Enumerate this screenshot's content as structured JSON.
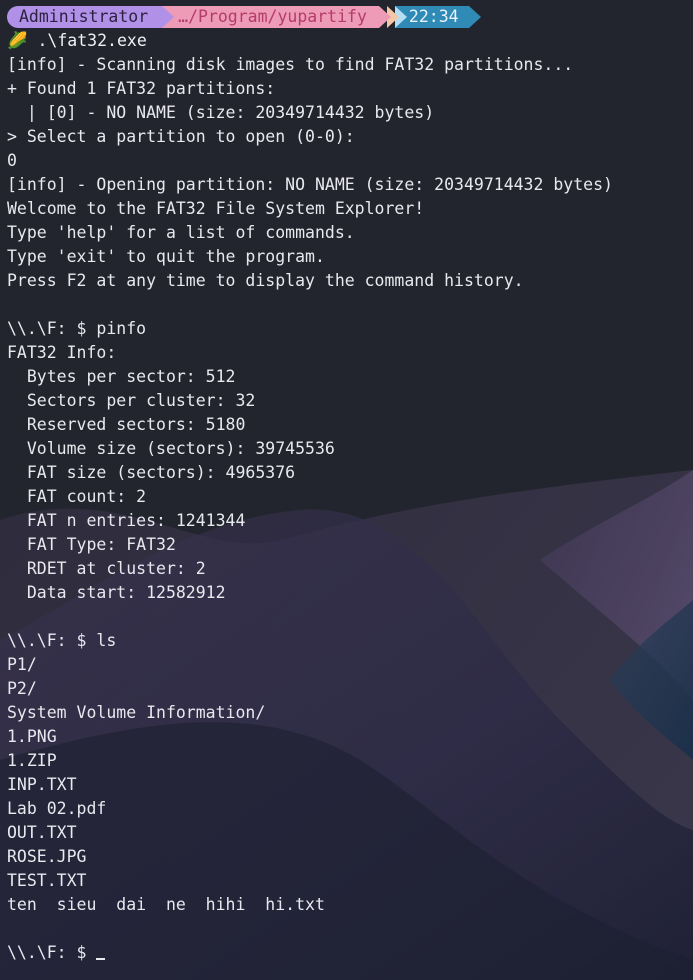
{
  "prompt": {
    "user": "Administrator",
    "path": "…/Program/yupartify",
    "time": "22:34"
  },
  "command": {
    "icon": "🌽",
    "text": ".\\fat32.exe"
  },
  "output_lines": [
    "[info] - Scanning disk images to find FAT32 partitions...",
    "+ Found 1 FAT32 partitions:",
    "  | [0] - NO NAME (size: 20349714432 bytes)",
    "> Select a partition to open (0-0):",
    "0",
    "[info] - Opening partition: NO NAME (size: 20349714432 bytes)",
    "Welcome to the FAT32 File System Explorer!",
    "Type 'help' for a list of commands.",
    "Type 'exit' to quit the program.",
    "Press F2 at any time to display the command history.",
    "",
    "\\\\.\\F: $ pinfo",
    "FAT32 Info:",
    "  Bytes per sector: 512",
    "  Sectors per cluster: 32",
    "  Reserved sectors: 5180",
    "  Volume size (sectors): 39745536",
    "  FAT size (sectors): 4965376",
    "  FAT count: 2",
    "  FAT n entries: 1241344",
    "  FAT Type: FAT32",
    "  RDET at cluster: 2",
    "  Data start: 12582912",
    "",
    "\\\\.\\F: $ ls",
    "P1/",
    "P2/",
    "System Volume Information/",
    "1.PNG",
    "1.ZIP",
    "INP.TXT",
    "Lab 02.pdf",
    "OUT.TXT",
    "ROSE.JPG",
    "TEST.TXT",
    "ten  sieu  dai  ne  hihi  hi.txt",
    ""
  ],
  "final_prompt": "\\\\.\\F: $ ",
  "colors": {
    "background": "#23252e",
    "user_segment": "#b190e8",
    "path_segment": "#ee9bb7",
    "time_segment": "#2f8ab6",
    "text": "#e8e8ee"
  }
}
